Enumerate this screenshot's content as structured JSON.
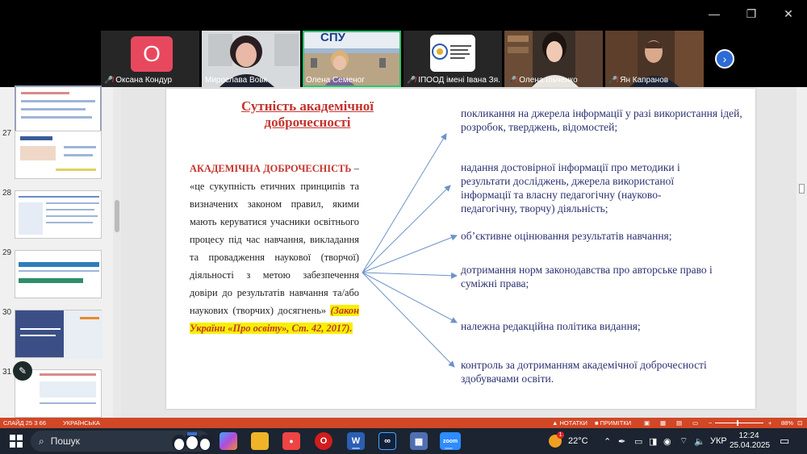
{
  "window": {
    "controls": [
      "—",
      "❐",
      "✕"
    ]
  },
  "participants": [
    {
      "name": "Оксана Кондур",
      "muted": true,
      "avatar_letter": "O",
      "type": "avatar"
    },
    {
      "name": "Мирослава Вовк",
      "muted": false,
      "type": "video"
    },
    {
      "name": "Олена Семеног",
      "muted": false,
      "type": "video-active",
      "logo": "СПУ"
    },
    {
      "name": "ІПООД імені Івана Зя...",
      "muted": true,
      "type": "logo"
    },
    {
      "name": "Олена Ільченко",
      "muted": true,
      "type": "video"
    },
    {
      "name": "Ян Капранов",
      "muted": true,
      "type": "video"
    }
  ],
  "next_arrow": "›",
  "thumbnails": [
    {
      "num": "",
      "selected": true
    },
    {
      "num": "27",
      "selected": false
    },
    {
      "num": "28",
      "selected": false
    },
    {
      "num": "29",
      "selected": false
    },
    {
      "num": "30",
      "selected": false
    },
    {
      "num": "31",
      "selected": false
    }
  ],
  "slide": {
    "title_line1": "Сутність академічної",
    "title_line2": "доброчесності",
    "term": "АКАДЕМІЧНА ДОБРОЧЕСНІСТЬ",
    "definition": " – «це сукупність етичних принципів та визначених законом правил, якими мають керуватися учасники освітнього процесу під час навчання, викладання та провадження наукової (творчої) діяльності з метою забезпечення довіри до результатів навчання та/або наукових (творчих) досягнень»",
    "source": "(Закон України «Про освіту», Ст. 42, 2017).",
    "items": [
      "покликання на джерела інформації у разі використання ідей, розробок, тверджень, відомостей;",
      "надання достовірної інформації про методики і результати досліджень, джерела використаної інформації та власну педагогічну (науково-педагогічну, творчу) діяльність;",
      " об’єктивне оцінювання результатів навчання;",
      "дотримання норм законодавства про авторське право і суміжні права;",
      "належна редакційна політика видання;",
      "контроль за дотриманням академічної доброчесності здобувачами освіти."
    ]
  },
  "statusbar": {
    "slide_info": "СЛАЙД 25 З 66",
    "language": "УКРАЇНСЬКА",
    "notes": "НОТАТКИ",
    "comments": "ПРИМІТКИ",
    "zoom": "88%"
  },
  "taskbar": {
    "search_placeholder": "Пошук",
    "weather": "22°C",
    "keyboard": "УКР",
    "time": "12:24",
    "date": "25.04.2025",
    "weather_badge": "1"
  },
  "colors": {
    "accent_red": "#c3342d",
    "text_blue": "#2a3170",
    "status_bar": "#d24726",
    "highlight": "#f6f000",
    "active_tile": "#2bc66b"
  }
}
